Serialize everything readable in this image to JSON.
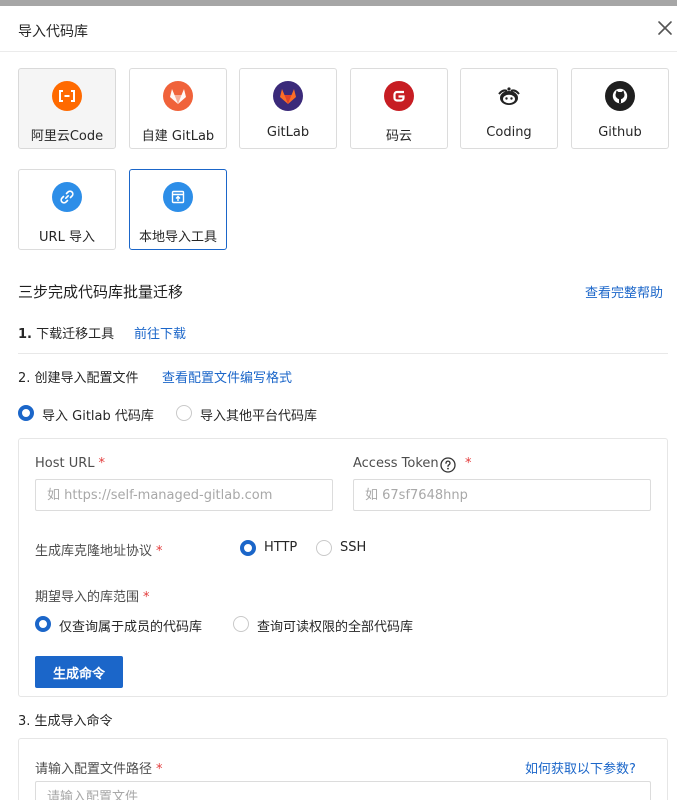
{
  "dialog": {
    "title": "导入代码库"
  },
  "sources": [
    {
      "label": "阿里云Code",
      "icon": "aliyun-code-icon",
      "color": "#ff6a00"
    },
    {
      "label": "自建 GitLab",
      "icon": "self-hosted-gitlab-icon",
      "color": "#f0623a"
    },
    {
      "label": "GitLab",
      "icon": "gitlab-icon",
      "color": "#3b2a7a"
    },
    {
      "label": "码云",
      "icon": "gitee-icon",
      "color": "#c71d23"
    },
    {
      "label": "Coding",
      "icon": "coding-icon",
      "color": "#222222"
    },
    {
      "label": "Github",
      "icon": "github-icon",
      "color": "#1f1f1f"
    },
    {
      "label": "URL 导入",
      "icon": "link-icon",
      "color": "#2d8ee8"
    },
    {
      "label": "本地导入工具",
      "icon": "local-import-icon",
      "color": "#2d8ee8"
    }
  ],
  "migration": {
    "title": "三步完成代码库批量迁移",
    "help_link": "查看完整帮助",
    "step1": {
      "num": "1.",
      "label": "下载迁移工具",
      "link": "前往下载"
    },
    "step2": {
      "label": "2. 创建导入配置文件",
      "link": "查看配置文件编写格式"
    },
    "platform_options": [
      {
        "label": "导入 Gitlab 代码库",
        "selected": true
      },
      {
        "label": "导入其他平台代码库",
        "selected": false
      }
    ],
    "form": {
      "host_url": {
        "label": "Host URL",
        "required": "*",
        "placeholder": "如 https://self-managed-gitlab.com"
      },
      "access_token": {
        "label": "Access Token",
        "required": "*",
        "placeholder": "如 67sf7648hnp"
      },
      "protocol": {
        "label": "生成库克隆地址协议",
        "required": "*",
        "options": [
          {
            "label": "HTTP",
            "selected": true
          },
          {
            "label": "SSH",
            "selected": false
          }
        ]
      },
      "scope": {
        "label": "期望导入的库范围",
        "required": "*",
        "options": [
          {
            "label": "仅查询属于成员的代码库",
            "selected": true
          },
          {
            "label": "查询可读权限的全部代码库",
            "selected": false
          }
        ]
      },
      "generate_button": "生成命令"
    },
    "step3": {
      "label": "3. 生成导入命令"
    },
    "config_path": {
      "label": "请输入配置文件路径",
      "required": "*",
      "help_link": "如何获取以下参数?",
      "placeholder": "请输入配置文件"
    }
  },
  "colors": {
    "accent": "#1b66c9",
    "required": "#e33b3b"
  }
}
